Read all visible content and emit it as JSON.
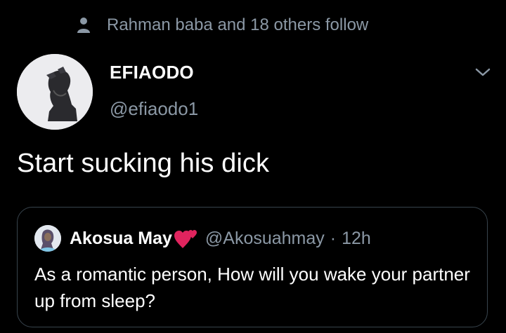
{
  "social_context": {
    "icon": "person-icon",
    "text": "Rahman baba and 18 others follow"
  },
  "author": {
    "name": "EFIAODO",
    "handle": "@efiaodo1",
    "avatar": "profile-photo"
  },
  "menu": {
    "icon": "chevron-down-icon"
  },
  "tweet": {
    "text": "Start sucking his dick"
  },
  "quoted_tweet": {
    "name": "Akosua May",
    "emoji": "two-hearts-icon",
    "handle": "@Akosuahmay",
    "separator": "·",
    "time": "12h",
    "text": "As a romantic person, How will you wake your partner up from sleep?"
  },
  "colors": {
    "background": "#000000",
    "primary_text": "#ffffff",
    "secondary_text": "#8b98a5",
    "border": "#38444d",
    "heart": "#e0245e"
  }
}
